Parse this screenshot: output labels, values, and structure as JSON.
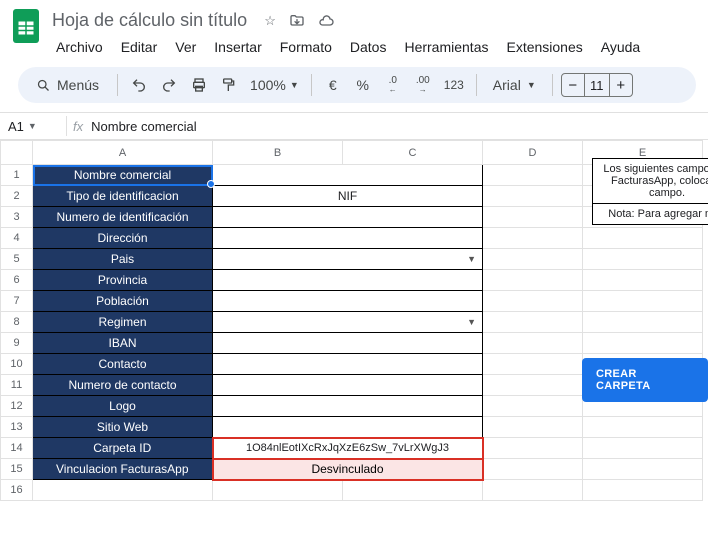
{
  "doc": {
    "title": "Hoja de cálculo sin título"
  },
  "menu": {
    "file": "Archivo",
    "edit": "Editar",
    "view": "Ver",
    "insert": "Insertar",
    "format": "Formato",
    "data": "Datos",
    "tools": "Herramientas",
    "extensions": "Extensiones",
    "help": "Ayuda"
  },
  "toolbar": {
    "search_label": "Menús",
    "zoom": "100%",
    "currency": "€",
    "percent": "%",
    "dec_dec": ".0",
    "dec_inc": ".00",
    "num123": "123",
    "font": "Arial",
    "font_size": "11"
  },
  "namebox": "A1",
  "formula": "Nombre comercial",
  "columns": [
    "A",
    "B",
    "C",
    "D",
    "E"
  ],
  "rows": [
    "1",
    "2",
    "3",
    "4",
    "5",
    "6",
    "7",
    "8",
    "9",
    "10",
    "11",
    "12",
    "13",
    "14",
    "15",
    "16"
  ],
  "labels": {
    "r1": "Nombre comercial",
    "r2": "Tipo de identificacion",
    "r3": "Numero de identificación",
    "r4": "Dirección",
    "r5": "Pais",
    "r6": "Provincia",
    "r7": "Población",
    "r8": "Regimen",
    "r9": "IBAN",
    "r10": "Contacto",
    "r11": "Numero de contacto",
    "r12": "Logo",
    "r13": "Sitio Web",
    "r14": "Carpeta ID",
    "r15": "Vinculacion FacturasApp"
  },
  "values": {
    "nif": "NIF",
    "carpeta_id": "1O84nlEotIXcRxJqXzE6zSw_7vLrXWgJ3",
    "desvinculado": "Desvinculado"
  },
  "note": {
    "line1": "Los siguientes campos de FacturasApp, coloca el campo.",
    "line2": "Nota: Para agregar más"
  },
  "button": {
    "crear": "CREAR CARPETA"
  }
}
